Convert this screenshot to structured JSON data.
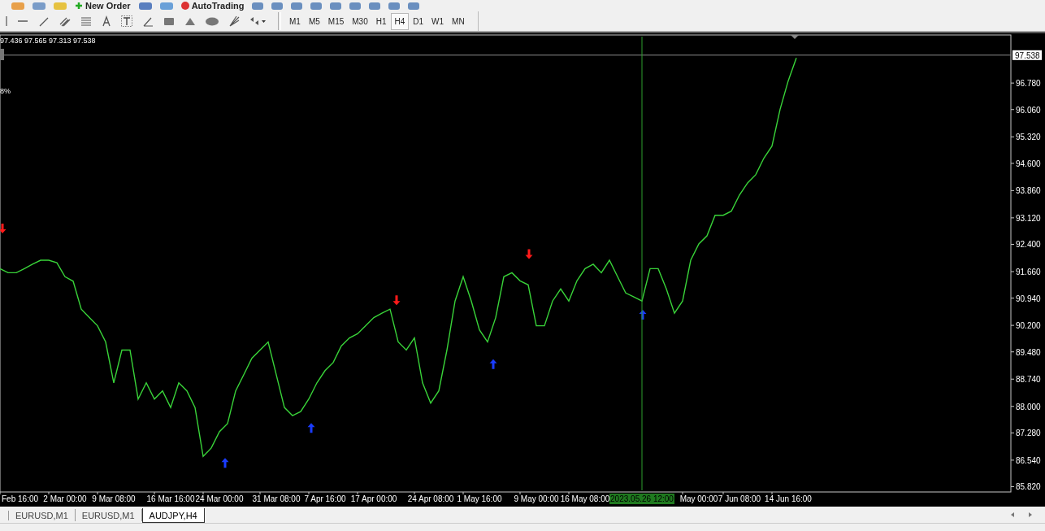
{
  "toolbar": {
    "buttons": [
      {
        "label": "New Order"
      },
      {
        "label": "AutoTrading"
      }
    ],
    "timeframes": [
      {
        "label": "M1",
        "selected": false
      },
      {
        "label": "M5",
        "selected": false
      },
      {
        "label": "M15",
        "selected": false
      },
      {
        "label": "M30",
        "selected": false
      },
      {
        "label": "H1",
        "selected": false
      },
      {
        "label": "H4",
        "selected": true
      },
      {
        "label": "D1",
        "selected": false
      },
      {
        "label": "W1",
        "selected": false
      },
      {
        "label": "MN",
        "selected": false
      }
    ]
  },
  "chart": {
    "ohlc_header": "97.436 97.565 97.313 97.538",
    "indicator_label": "8%",
    "chart_data": {
      "type": "line",
      "ylim": [
        85.72,
        98.13
      ],
      "categories": [
        null,
        null,
        "Feb 16:00",
        null,
        null,
        null,
        null,
        null,
        "2 Mar 00:00",
        null,
        null,
        null,
        null,
        null,
        "9 Mar 08:00",
        null,
        null,
        null,
        null,
        null,
        null,
        "16 Mar 16:00",
        null,
        null,
        null,
        null,
        null,
        "24 Mar 00:00",
        null,
        null,
        null,
        null,
        null,
        null,
        "31 Mar 08:00",
        null,
        null,
        null,
        null,
        null,
        "7 Apr 16:00",
        null,
        null,
        null,
        null,
        null,
        "17 Apr 00:00",
        null,
        null,
        null,
        null,
        null,
        null,
        "24 Apr 08:00",
        null,
        null,
        null,
        null,
        null,
        "1 May 16:00",
        null,
        null,
        null,
        null,
        null,
        null,
        "9 May 00:00",
        null,
        null,
        null,
        null,
        null,
        "16 May 08:00",
        null,
        null,
        null,
        null,
        null,
        null,
        "2023.05.26 12:00",
        null,
        null,
        null,
        null,
        null,
        null,
        "May 00:00",
        null,
        null,
        null,
        null,
        "7 Jun 08:00",
        null,
        null,
        null,
        null,
        null,
        "14 Jun 16:00",
        null
      ],
      "series": [
        {
          "color": "#39d339",
          "values": [
            91.74,
            91.63,
            91.63,
            91.74,
            91.86,
            91.97,
            91.97,
            91.9,
            91.52,
            91.4,
            90.64,
            90.41,
            90.19,
            89.75,
            88.64,
            89.53,
            89.53,
            88.2,
            88.64,
            88.2,
            88.42,
            87.97,
            88.64,
            88.42,
            87.97,
            86.64,
            86.87,
            87.31,
            87.53,
            88.42,
            88.86,
            89.31,
            89.53,
            89.75,
            88.86,
            87.97,
            87.75,
            87.86,
            88.2,
            88.64,
            88.97,
            89.19,
            89.64,
            89.86,
            89.97,
            90.19,
            90.41,
            90.53,
            90.64,
            89.75,
            89.53,
            89.86,
            88.64,
            88.09,
            88.42,
            89.53,
            90.86,
            91.52,
            90.86,
            90.08,
            89.75,
            90.41,
            91.52,
            91.63,
            91.41,
            91.3,
            90.19,
            90.19,
            90.86,
            91.19,
            90.86,
            91.41,
            91.74,
            91.86,
            91.63,
            91.97,
            91.52,
            91.08,
            90.97,
            90.86,
            91.74,
            91.74,
            91.19,
            90.53,
            90.86,
            91.97,
            92.41,
            92.63,
            93.19,
            93.19,
            93.3,
            93.74,
            94.07,
            94.29,
            94.74,
            95.07,
            96.07,
            96.84,
            97.46
          ]
        }
      ],
      "yticks": [
        {
          "value": 96.78,
          "label": "96.780"
        },
        {
          "value": 96.06,
          "label": "96.060"
        },
        {
          "value": 95.32,
          "label": "95.320"
        },
        {
          "value": 94.6,
          "label": "94.600"
        },
        {
          "value": 93.86,
          "label": "93.860"
        },
        {
          "value": 93.12,
          "label": "93.120"
        },
        {
          "value": 92.4,
          "label": "92.400"
        },
        {
          "value": 91.66,
          "label": "91.660"
        },
        {
          "value": 90.94,
          "label": "90.940"
        },
        {
          "value": 90.2,
          "label": "90.200"
        },
        {
          "value": 89.48,
          "label": "89.480"
        },
        {
          "value": 88.74,
          "label": "88.740"
        },
        {
          "value": 88,
          "label": "88.000"
        },
        {
          "value": 87.28,
          "label": "87.280"
        },
        {
          "value": 86.54,
          "label": "86.540"
        },
        {
          "value": 85.82,
          "label": "85.820"
        }
      ],
      "ref_lines": [
        {
          "axis": "y",
          "value": 97.538,
          "label": "97.538"
        },
        {
          "axis": "x",
          "value": "2023.05.26 12:00"
        }
      ]
    }
  },
  "tabs": [
    {
      "label": "EURUSD,M1",
      "selected": false
    },
    {
      "label": "EURUSD,M1",
      "selected": false
    },
    {
      "label": "AUDJPY,H4",
      "selected": true
    }
  ]
}
